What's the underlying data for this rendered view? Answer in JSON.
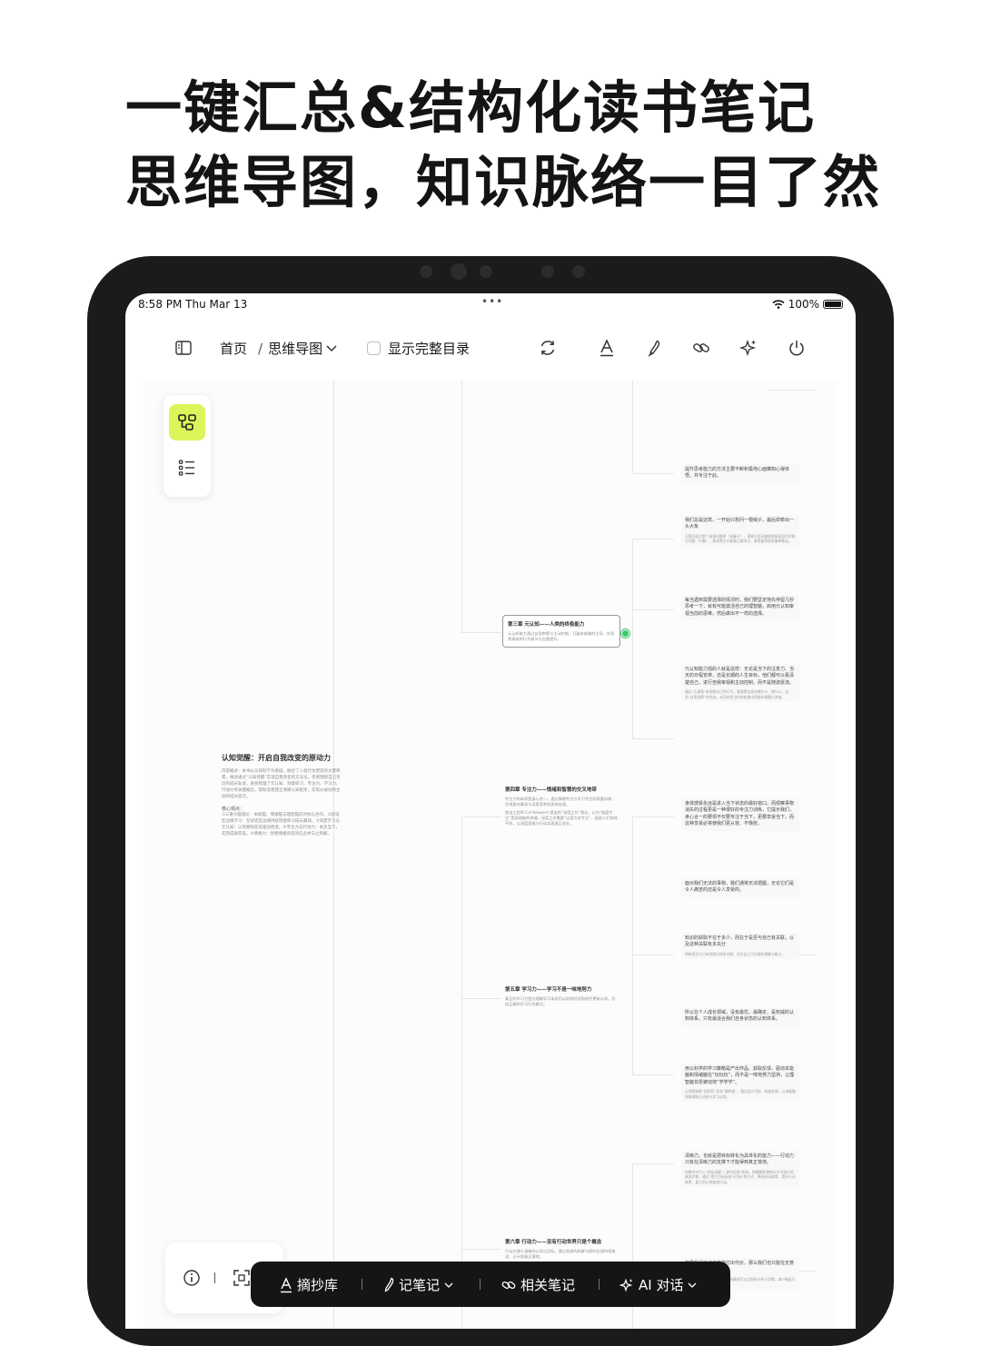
{
  "headline": {
    "line1": "一键汇总&结构化读书笔记",
    "line2": "思维导图，知识脉络一目了然"
  },
  "status_bar": {
    "time": "8:58 PM  Thu Mar 13",
    "battery": "100%"
  },
  "toolbar": {
    "home": "首页",
    "separator": "/",
    "view_mode": "思维导图",
    "show_full_toc": "显示完整目录"
  },
  "mindmap": {
    "root": {
      "title": "认知觉醒：开启自我改变的原动力",
      "summary": "内容概述：本书以认知科学为基础，融合了人类行为塑造的大量积累，阐述通过“认知觉醒”实现自我改变的方法论。作者围绕自己亲历的成长轨迹，系统梳理了元认知、刻意练习、专注力、学习力、行动力等关键概念，帮助读者建立清晰认知框架，实现从被动到主动的成长跃迁。",
      "sub_label": "核心观点：",
      "sub_text": "①三重大脑理论：本能脑、情绪脑与理智脑的对抗与合作。②舒适区边缘学习：在舒适区边缘持续刻意练习成长最快。③深度学习与元认知：以觉察和反思驱动改变。④专注力与行动力：关注当下，先完成再完美。⑤情绪力：觉察情绪背后的信念并与之和解。"
    },
    "chapters": [
      {
        "title": "第三章 元认知——人类的终极能力",
        "desc": "元认知能力通过自我审视与主动控制，打破本能脑的主导，实现更高效的行为调节与自我提升。"
      },
      {
        "title": "第四章 专注力——情绪和智慧的交叉地带",
        "desc": "专注力的本质是身心合一。通过情绪专注与学习专注的双重训练，实现复杂事务与深度思考的高效处理。",
        "note": "提出工程师 Cal Newport 提出的“深度工作”理念，认为“极度专注”是高效能的关键。深度工作需要“过度力求专注”，鼓励人们排除干扰，以深度思维与行动实现真正成长。"
      },
      {
        "title": "第五章 学习力——学习不是一味地努力",
        "desc": "真正的学习力是在理解学习本质后以实践验证和迭代更新认知，形成正确的学习行为模式。"
      },
      {
        "title": "第六章 行动力——没有行动世界只是个概念",
        "desc": "行动力源于清晰的认知与目标，通过具体的拆解与即时反馈持续推进，让计划真正落地。"
      }
    ],
    "leaves": [
      {
        "text": "提升思考能力的方法主要不断积极地心面推知心得体悟，并专注于此。",
        "sub": ""
      },
      {
        "text": "我们总是这样，一开始只想问一根绳子，最后却牵出一头大象",
        "sub": "当我们面对某个具体问题时（如绳子），潜意识会迅速联想更深层的关联与问题（大象），看清楚它才能真正解决它，避免被表面现象牵着走。"
      },
      {
        "text": "每当遇到需要选择的情况时，我们要坚定地先停留几秒思考一下，就有可能激活自己的理智脑，启用元认知审视当前的思维，然后做出不一样的选择。",
        "sub": ""
      },
      {
        "text": "元认知能力强的人就是这样：无论是当下的注意力、当天的日程安排，还是长期的人生目标，他们都可以看清楚自己，进行自我审视和主动控制，而不是随波逐流。",
        "sub": "通过“元视角”来观察自己的行为，看清楚自身在做什么、想什么，达到“自我觉察”的状态，从而在恰当的时机做出积极的调整与改变。"
      },
      {
        "text": "身体感受永远是进入当下状态的最好窗口，而观察事物消失的过程更是一种很好的专注力训练，它提示我们，身心合一的要领不仅要专注于当下，更要享受当下，而这种享受必将使我们更从容、不慌张。",
        "sub": ""
      },
      {
        "text": "面对我们无法的事物，我们通常无法把握，无论它们是令人痛苦的还是令人享受的。",
        "sub": ""
      },
      {
        "text": "知识的获取不在于多少，而在于是否与自己有关联，以及这种关联有多充分",
        "sub": "将新知识与已有的知识体系关联，化为自己可迁移的理解与能力。"
      },
      {
        "text": "所以在个人成长领域，没有最优，最确定，是权威的认知体系，只有最适合我们自身状态的认知体系。",
        "sub": ""
      },
      {
        "text": "用以科学的学习策略是产出作品、获取反馈，驱动本能脑和情绪脑在“玩玩玩”，而不是一味地努力坚持，让理智脑甘愿被动地“学学学”。",
        "sub": "让理智脑做“指挥官”而非“搬砖者”，通过设计目标、制造反馈，让本能脑和情绪脑主动参与学习过程。"
      },
      {
        "text": "清晰力，也就是把目标转化为具体化的能力——行动力只有在清晰力的支撑下才能得到真正落地。",
        "sub": "在教学中引入“目标拆解 + 即时反馈”机制，把模糊愿望转化为可执行的具体步骤，通过“把大目标拆成小目标”的方式，降低启动难度，提升行动效率，真正把计划变成行动。"
      },
      {
        "text": "如果我们无法自由地付出代价，那么我们也只能在无意识中被生活推着走。",
        "sub": "从当下开始采取行动，让目标拆解成可以立即执行的小步骤，减少拖延与焦虑。"
      }
    ]
  },
  "bottom_dock": {
    "excerpts": "摘抄库",
    "take_notes": "记笔记",
    "related_notes": "相关笔记",
    "ai_chat": "AI 对话"
  },
  "colors": {
    "accent": "#dcf55a",
    "dock_bg": "#151515",
    "node_dot": "#37c76a",
    "device_frame": "#1b1b1b"
  },
  "icons": [
    "sidebar-toggle-icon",
    "chevron-down-icon",
    "refresh-icon",
    "text-style-icon",
    "pen-icon",
    "link-icon",
    "ai-sparkle-icon",
    "power-icon",
    "mindmap-icon",
    "list-icon",
    "info-icon",
    "fullscreen-icon",
    "highlight-icon",
    "note-pen-icon",
    "related-link-icon",
    "ai-chat-icon"
  ]
}
